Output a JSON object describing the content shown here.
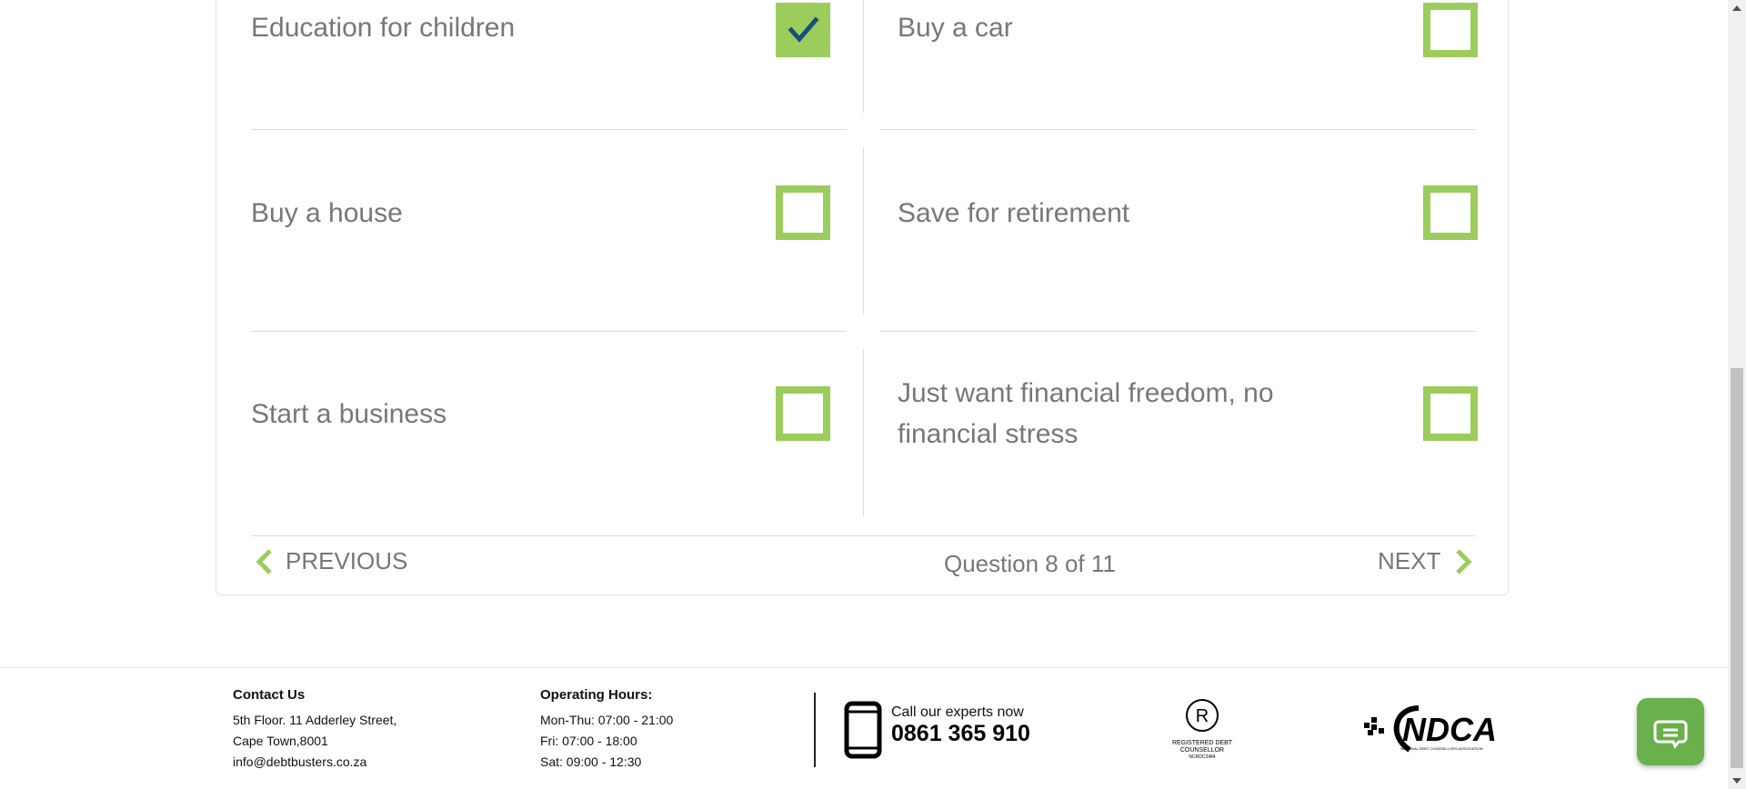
{
  "options": [
    {
      "label": "Education for children",
      "checked": true
    },
    {
      "label": "Buy a car",
      "checked": false
    },
    {
      "label": "Buy a house",
      "checked": false
    },
    {
      "label": "Save for retirement",
      "checked": false
    },
    {
      "label": "Start a business",
      "checked": false
    },
    {
      "label": "Just want financial freedom, no financial stress",
      "checked": false
    }
  ],
  "navigation": {
    "previous_label": "PREVIOUS",
    "question_label": "Question 8 of 11",
    "next_label": "NEXT"
  },
  "colors": {
    "accent": "#9ccd5c",
    "check_mark": "#17507a",
    "text": "#777777"
  },
  "footer": {
    "contact": {
      "heading": "Contact Us",
      "address_line1": "5th Floor. 11 Adderley Street,",
      "address_line2": "Cape Town,8001",
      "email": "info@debtbusters.co.za"
    },
    "hours": {
      "heading": "Operating Hours:",
      "line1": "Mon-Thu: 07:00 - 21:00",
      "line2": "Fri: 07:00 - 18:00",
      "line3": "Sat: 09:00 - 12:30"
    },
    "phone": {
      "label": "Call our experts now",
      "number": "0861 365 910"
    },
    "registered_logo": {
      "text": "REGISTERED DEBT COUNSELLOR",
      "reg_number": "NCRDC2484"
    },
    "ndca_logo": {
      "text": "NDCA",
      "subtext": "NATIONAL DEBT COUNSELLORS ASSOCIATION"
    }
  },
  "chat": {
    "icon": "chat-bubble-icon"
  }
}
